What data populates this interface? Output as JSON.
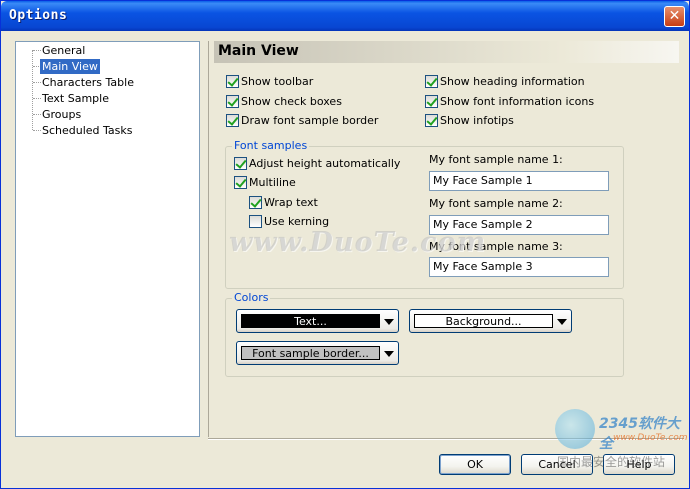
{
  "window": {
    "title": "Options",
    "close_glyph": "✕"
  },
  "tree": {
    "items": [
      {
        "label": "General",
        "selected": false
      },
      {
        "label": "Main View",
        "selected": true
      },
      {
        "label": "Characters Table",
        "selected": false
      },
      {
        "label": "Text Sample",
        "selected": false
      },
      {
        "label": "Groups",
        "selected": false
      },
      {
        "label": "Scheduled Tasks",
        "selected": false
      }
    ]
  },
  "header": {
    "title": "Main View"
  },
  "options": {
    "show_toolbar": {
      "label": "Show toolbar",
      "checked": true
    },
    "show_check_boxes": {
      "label": "Show check boxes",
      "checked": true
    },
    "draw_border": {
      "label": "Draw font sample border",
      "checked": true
    },
    "show_heading": {
      "label": "Show heading information",
      "checked": true
    },
    "show_font_icons": {
      "label": "Show font information icons",
      "checked": true
    },
    "show_infotips": {
      "label": "Show infotips",
      "checked": true
    }
  },
  "font_samples": {
    "legend": "Font samples",
    "adjust_height": {
      "label": "Adjust height automatically",
      "checked": true
    },
    "multiline": {
      "label": "Multiline",
      "checked": true
    },
    "wrap_text": {
      "label": "Wrap text",
      "checked": true
    },
    "use_kerning": {
      "label": "Use kerning",
      "checked": false
    },
    "name1_label": "My font sample name 1:",
    "name1_value": "My Face Sample 1",
    "name2_label": "My font sample name 2:",
    "name2_value": "My Face Sample 2",
    "name3_label": "My font sample name 3:",
    "name3_value": "My Face Sample 3"
  },
  "colors": {
    "legend": "Colors",
    "text_label": "Text...",
    "text_color": "#000000",
    "background_label": "Background...",
    "background_color": "#ffffff",
    "border_label": "Font sample border...",
    "border_color": "#c0c0c0"
  },
  "buttons": {
    "ok": "OK",
    "cancel": "Cancel",
    "help": "Help"
  },
  "watermarks": {
    "main": "www.DuoTe.com",
    "brand": "2345软件大全",
    "url": "www.DuoTe.com",
    "cn": "国内最安全的软件站"
  }
}
